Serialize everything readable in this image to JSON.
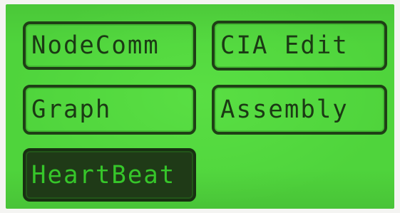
{
  "menu": {
    "items": [
      {
        "label": "NodeComm",
        "selected": false
      },
      {
        "label": "CIA Edit",
        "selected": false
      },
      {
        "label": "Graph",
        "selected": false
      },
      {
        "label": "Assembly",
        "selected": false
      },
      {
        "label": "HeartBeat",
        "selected": true
      }
    ]
  },
  "colors": {
    "lcd_background": "#4fd43c",
    "pixel_dark": "#1f3f16",
    "selected_text": "#36c62a"
  }
}
